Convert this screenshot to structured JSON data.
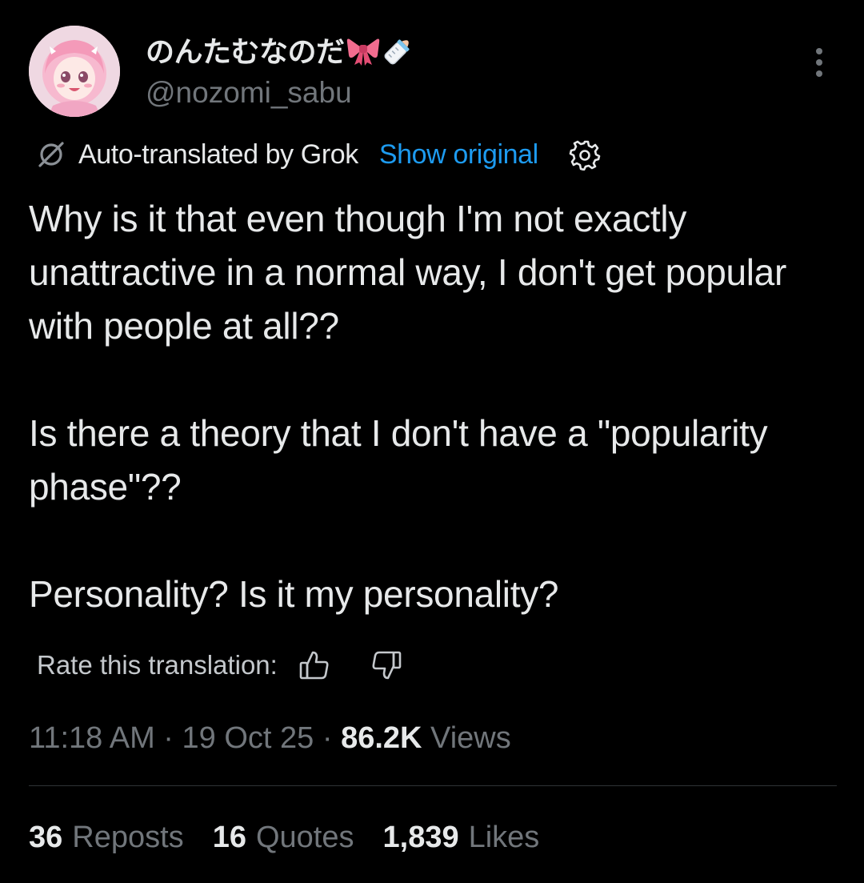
{
  "author": {
    "display_name": "のんたむなのだ",
    "emoji": [
      "ribbon-emoji",
      "baby-bottle-emoji"
    ],
    "handle": "@nozomi_sabu"
  },
  "translation": {
    "label": "Auto-translated by Grok",
    "show_original": "Show original",
    "icon": "grok-icon",
    "settings_icon": "gear-icon"
  },
  "tweet": {
    "paragraphs": [
      "Why is it that even though I'm not exactly unattractive in a normal way, I don't get popular with people at all??",
      "Is there a theory that I don't have a \"popularity phase\"??",
      "Personality? Is it my personality?"
    ]
  },
  "rate": {
    "label": "Rate this translation:"
  },
  "meta": {
    "time": "11:18 AM",
    "date": "19 Oct 25",
    "views_count": "86.2K",
    "views_label": "Views"
  },
  "stats": {
    "reposts_count": "36",
    "reposts_label": "Reposts",
    "quotes_count": "16",
    "quotes_label": "Quotes",
    "likes_count": "1,839",
    "likes_label": "Likes"
  },
  "colors": {
    "background": "#000000",
    "text": "#e7e9ea",
    "secondary": "#71767b",
    "accent": "#1d9bf0",
    "divider": "#2f3336"
  }
}
